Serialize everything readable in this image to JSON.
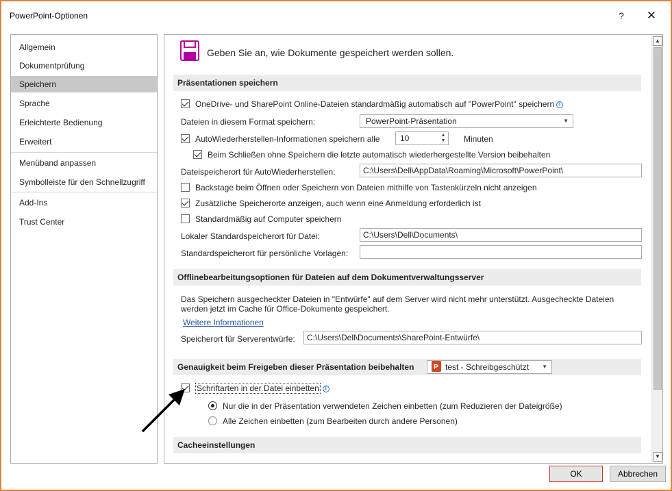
{
  "window": {
    "title": "PowerPoint-Optionen",
    "help_label": "?",
    "close_label": "✕"
  },
  "nav": {
    "items": [
      {
        "label": "Allgemein",
        "selected": false
      },
      {
        "label": "Dokumentprüfung",
        "selected": false
      },
      {
        "label": "Speichern",
        "selected": true
      },
      {
        "label": "Sprache",
        "selected": false
      },
      {
        "label": "Erleichterte Bedienung",
        "selected": false
      },
      {
        "label": "Erweitert",
        "selected": false
      },
      {
        "label": "Menüband anpassen",
        "selected": false
      },
      {
        "label": "Symbolleiste für den Schnellzugriff",
        "selected": false
      },
      {
        "label": "Add-Ins",
        "selected": false
      },
      {
        "label": "Trust Center",
        "selected": false
      }
    ]
  },
  "content": {
    "intro": "Geben Sie an, wie Dokumente gespeichert werden sollen.",
    "section_save": "Präsentationen speichern",
    "onedrive_label": "OneDrive- und SharePoint Online-Dateien standardmäßig automatisch auf \"PowerPoint\" speichern",
    "format_label": "Dateien in diesem Format speichern:",
    "format_value": "PowerPoint-Präsentation",
    "autorecover_label": "AutoWiederherstellen-Informationen speichern alle",
    "autorecover_minutes": "10",
    "minutes_label": "Minuten",
    "keep_last_label": "Beim Schließen ohne Speichern die letzte automatisch wiederhergestellte Version beibehalten",
    "autorecover_path_label": "Dateispeicherort für AutoWiederherstellen:",
    "autorecover_path": "C:\\Users\\Dell\\AppData\\Roaming\\Microsoft\\PowerPoint\\",
    "backstage_label": "Backstage beim Öffnen oder Speichern von Dateien mithilfe von Tastenkürzeln nicht anzeigen",
    "additional_locations_label": "Zusätzliche Speicherorte anzeigen, auch wenn eine Anmeldung erforderlich ist",
    "save_to_computer_label": "Standardmäßig auf Computer speichern",
    "local_path_label": "Lokaler Standardspeicherort für Datei:",
    "local_path": "C:\\Users\\Dell\\Documents\\",
    "templates_path_label": "Standardspeicherort für persönliche Vorlagen:",
    "templates_path": "",
    "section_offline": "Offlinebearbeitungsoptionen für Dateien auf dem Dokumentverwaltungsserver",
    "offline_text": "Das Speichern ausgecheckter Dateien in \"Entwürfe\" auf dem Server wird nicht mehr unterstützt. Ausgecheckte Dateien werden jetzt im Cache für Office-Dokumente gespeichert.",
    "more_info_link": "Weitere Informationen",
    "server_drafts_label": "Speicherort für Serverentwürfe:",
    "server_drafts_path": "C:\\Users\\Dell\\Documents\\SharePoint-Entwürfe\\",
    "section_fidelity": "Genauigkeit beim Freigeben dieser Präsentation beibehalten",
    "presentation_value": "test  -  Schreibgeschützt",
    "embed_fonts_label": "Schriftarten in der Datei einbetten",
    "embed_used_label": "Nur die in der Präsentation verwendeten Zeichen einbetten (zum Reduzieren der Dateigröße)",
    "embed_all_label": "Alle Zeichen einbetten (zum Bearbeiten durch andere Personen)",
    "section_cache": "Cacheeinstellungen"
  },
  "checks": {
    "onedrive": true,
    "autorecover": true,
    "keep_last": true,
    "backstage": false,
    "additional_locations": true,
    "save_to_computer": false,
    "embed_fonts": true
  },
  "buttons": {
    "ok": "OK",
    "cancel": "Abbrechen"
  },
  "colors": {
    "window_border": "#d9843f",
    "selected_nav": "#c8c8c8",
    "section_bg": "#ececec",
    "ok_border": "#c0392b",
    "link": "#2255a4",
    "save_icon": "#b4009e"
  },
  "icons": {
    "intro": "save-floppy-icon",
    "info": "info-icon",
    "presentation": "powerpoint-file-icon",
    "annotation": "arrow-annotation-icon"
  }
}
